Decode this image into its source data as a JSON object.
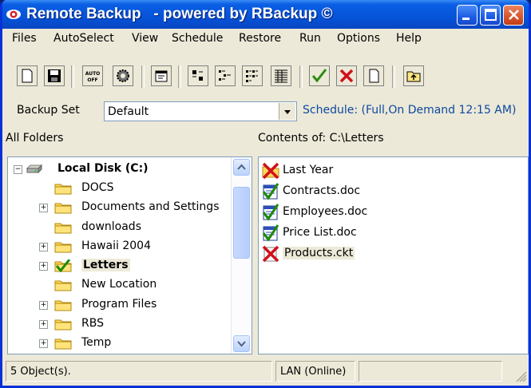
{
  "window": {
    "title": "Remote Backup   - powered by RBackup ©",
    "icons": {
      "app": "eye-logo-icon",
      "minimize": "minimize-icon",
      "maximize": "maximize-icon",
      "close": "close-icon"
    },
    "colors": {
      "titlebar": "#0553d8",
      "close": "#d8532a",
      "schedule_text": "#0d49a0"
    }
  },
  "menubar": {
    "items": [
      {
        "label": "Files"
      },
      {
        "label": "AutoSelect"
      },
      {
        "label": "View"
      },
      {
        "label": "Schedule"
      },
      {
        "label": "Restore"
      },
      {
        "label": "Run"
      },
      {
        "label": "Options"
      },
      {
        "label": "Help"
      }
    ]
  },
  "toolbar": {
    "buttons": [
      {
        "icon": "new-document-icon"
      },
      {
        "icon": "save-disk-icon"
      },
      {
        "icon": "auto-off-icon",
        "label": "AUTO OFF"
      },
      {
        "icon": "gear-icon"
      },
      {
        "icon": "properties-icon"
      },
      {
        "icon": "large-icons-view-icon"
      },
      {
        "icon": "small-icons-view-icon"
      },
      {
        "icon": "list-view-icon"
      },
      {
        "icon": "details-view-icon"
      },
      {
        "icon": "check-mark-icon"
      },
      {
        "icon": "red-x-icon"
      },
      {
        "icon": "blank-page-icon"
      },
      {
        "icon": "folder-up-icon"
      }
    ]
  },
  "backup_set": {
    "label": "Backup Set",
    "value": "Default",
    "schedule": "Schedule: (Full,On Demand 12:15 AM)"
  },
  "left_pane": {
    "header": "All Folders",
    "root": "Local Disk (C:)",
    "folders": [
      {
        "label": "DOCS",
        "expandable": false,
        "checked": false
      },
      {
        "label": "Documents and Settings",
        "expandable": true,
        "checked": false
      },
      {
        "label": "downloads",
        "expandable": false,
        "checked": false
      },
      {
        "label": "Hawaii 2004",
        "expandable": true,
        "checked": false
      },
      {
        "label": "Letters",
        "expandable": true,
        "checked": true
      },
      {
        "label": "New Location",
        "expandable": false,
        "checked": false
      },
      {
        "label": "Program Files",
        "expandable": true,
        "checked": false
      },
      {
        "label": "RBS",
        "expandable": true,
        "checked": false
      },
      {
        "label": "Temp",
        "expandable": true,
        "checked": false
      }
    ]
  },
  "right_pane": {
    "header": "Contents of: C:\\Letters",
    "items": [
      {
        "label": "Last Year",
        "state": "excluded-folder"
      },
      {
        "label": "Contracts.doc",
        "state": "included"
      },
      {
        "label": "Employees.doc",
        "state": "included"
      },
      {
        "label": "Price List.doc",
        "state": "included"
      },
      {
        "label": "Products.ckt",
        "state": "excluded"
      }
    ]
  },
  "statusbar": {
    "objects": "5 Object(s).",
    "connection": "LAN (Online)"
  }
}
